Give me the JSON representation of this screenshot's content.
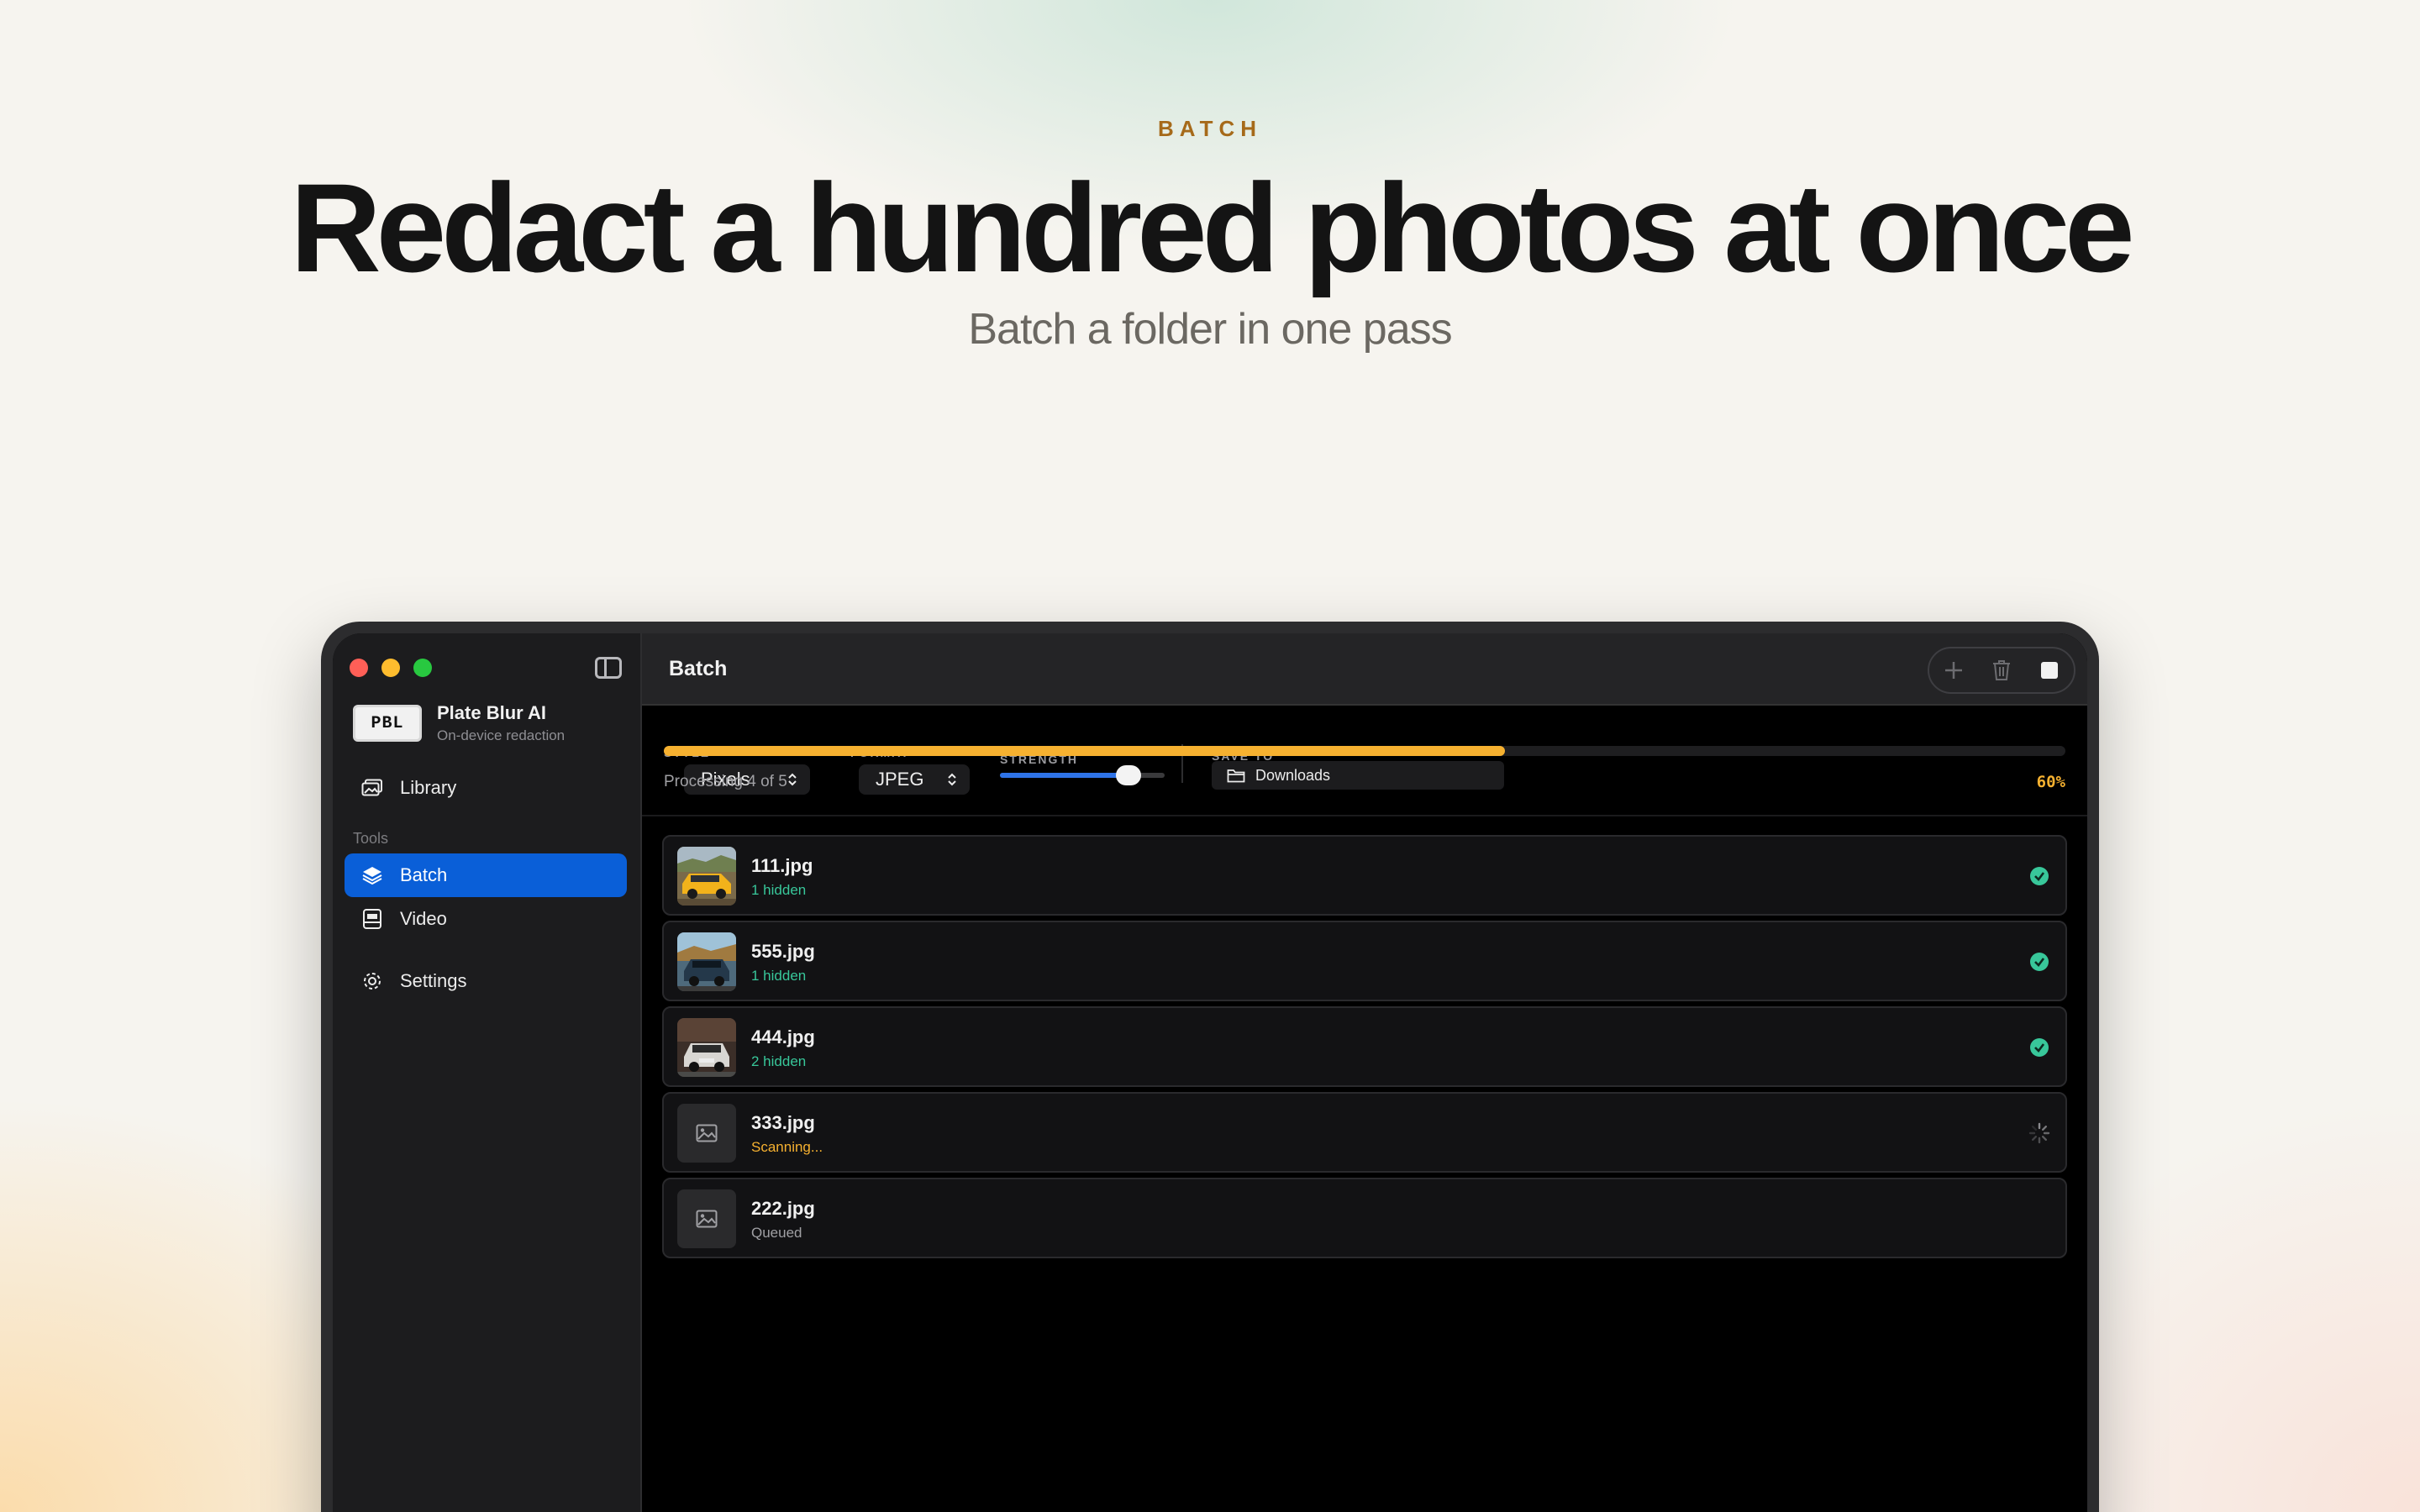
{
  "hero": {
    "eyebrow": "BATCH",
    "headline": "Redact a hundred photos at once",
    "subhead": "Batch a folder in one pass"
  },
  "app": {
    "brand_logo": "PBL",
    "brand_name": "Plate Blur AI",
    "brand_tagline": "On-device redaction",
    "window_title": "Batch"
  },
  "sidebar": {
    "section_tools": "Tools",
    "items": [
      {
        "label": "Library",
        "icon": "photo-library-icon"
      },
      {
        "label": "Batch",
        "icon": "stack-icon",
        "active": true
      },
      {
        "label": "Video",
        "icon": "film-icon"
      },
      {
        "label": "Settings",
        "icon": "gear-icon"
      }
    ]
  },
  "toolbar": {
    "add_icon": "plus-icon",
    "delete_icon": "trash-icon",
    "stop_icon": "stop-icon"
  },
  "controls": {
    "style_label": "STYLE",
    "style_value": "Pixels",
    "format_label": "FORMAT",
    "format_value": "JPEG",
    "strength_label": "STRENGTH",
    "strength_value": 0.78,
    "saveto_label": "SAVE TO",
    "saveto_value": "Downloads"
  },
  "progress": {
    "status": "Processing 4 of 5",
    "percent_label": "60%",
    "fraction": 0.6
  },
  "colors": {
    "accent_blue": "#0a5fd8",
    "progress_orange": "#f6b130",
    "done_green": "#38c79a"
  },
  "files": [
    {
      "name": "111.jpg",
      "status": "1 hidden",
      "state": "done"
    },
    {
      "name": "555.jpg",
      "status": "1 hidden",
      "state": "done"
    },
    {
      "name": "444.jpg",
      "status": "2 hidden",
      "state": "done"
    },
    {
      "name": "333.jpg",
      "status": "Scanning...",
      "state": "scanning"
    },
    {
      "name": "222.jpg",
      "status": "Queued",
      "state": "queued"
    }
  ]
}
